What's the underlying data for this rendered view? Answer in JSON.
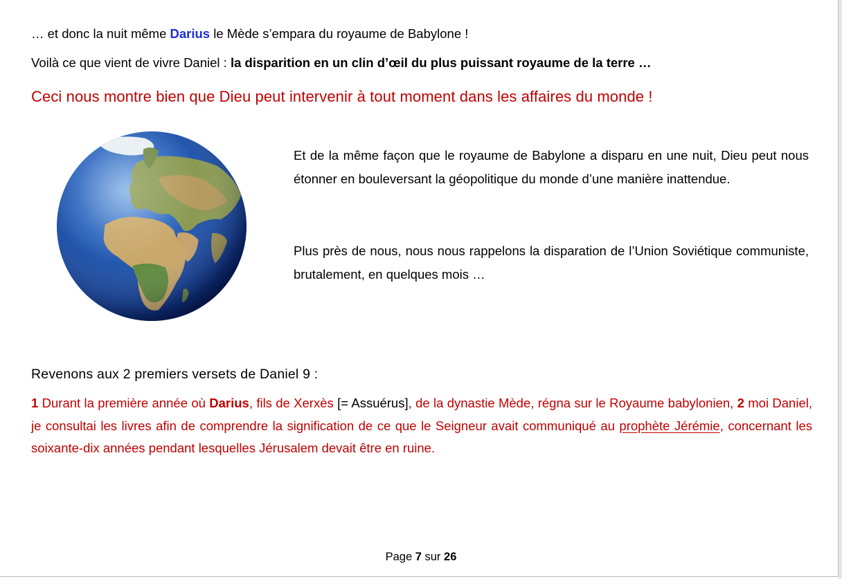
{
  "line1": {
    "before": "…  et donc la nuit même ",
    "name": "Darius",
    "after": " le Mède s’empara du royaume de Babylone !"
  },
  "line2": {
    "plain": "Voilà ce que vient de vivre Daniel : ",
    "bold": "la disparition en un clin d’œil du plus puissant royaume de la terre …"
  },
  "headline": "Ceci nous montre bien que Dieu peut intervenir à tout moment dans les affaires du monde !",
  "paragraph1": "Et de la même façon que le royaume de Babylone a disparu en une nuit, Dieu peut nous étonner en bouleversant la géopolitique du monde d’une manière inattendue.",
  "paragraph2": "Plus près de nous, nous nous rappelons la disparation de l’Union Soviétique communiste, brutalement, en quelques mois …",
  "subheading": "Revenons aux 2 premiers versets de Daniel 9 :",
  "verse": {
    "num1": "1",
    "t1": " Durant la première année où ",
    "darius": "Darius",
    "t2": ", fils de Xerxès ",
    "bracket": "[= Assuérus]",
    "t3": ", de la dynastie Mède, régna sur le Royaume babylonien, ",
    "num2": "2",
    "t4": " moi Daniel, je consultai les livres afin de comprendre la signification de ce que le Seigneur avait communiqué au ",
    "link": "prophète Jérémie",
    "t5": ", concernant les soixante-dix années pendant lesquelles Jérusalem devait être en ruine."
  },
  "footer": {
    "prefix": "Page ",
    "current": "7",
    "middle": " sur ",
    "total": "26"
  },
  "icons": {
    "globe": "earth-globe-icon"
  },
  "colors": {
    "accent_red": "#c00000",
    "name_blue": "#1b2fd6"
  }
}
